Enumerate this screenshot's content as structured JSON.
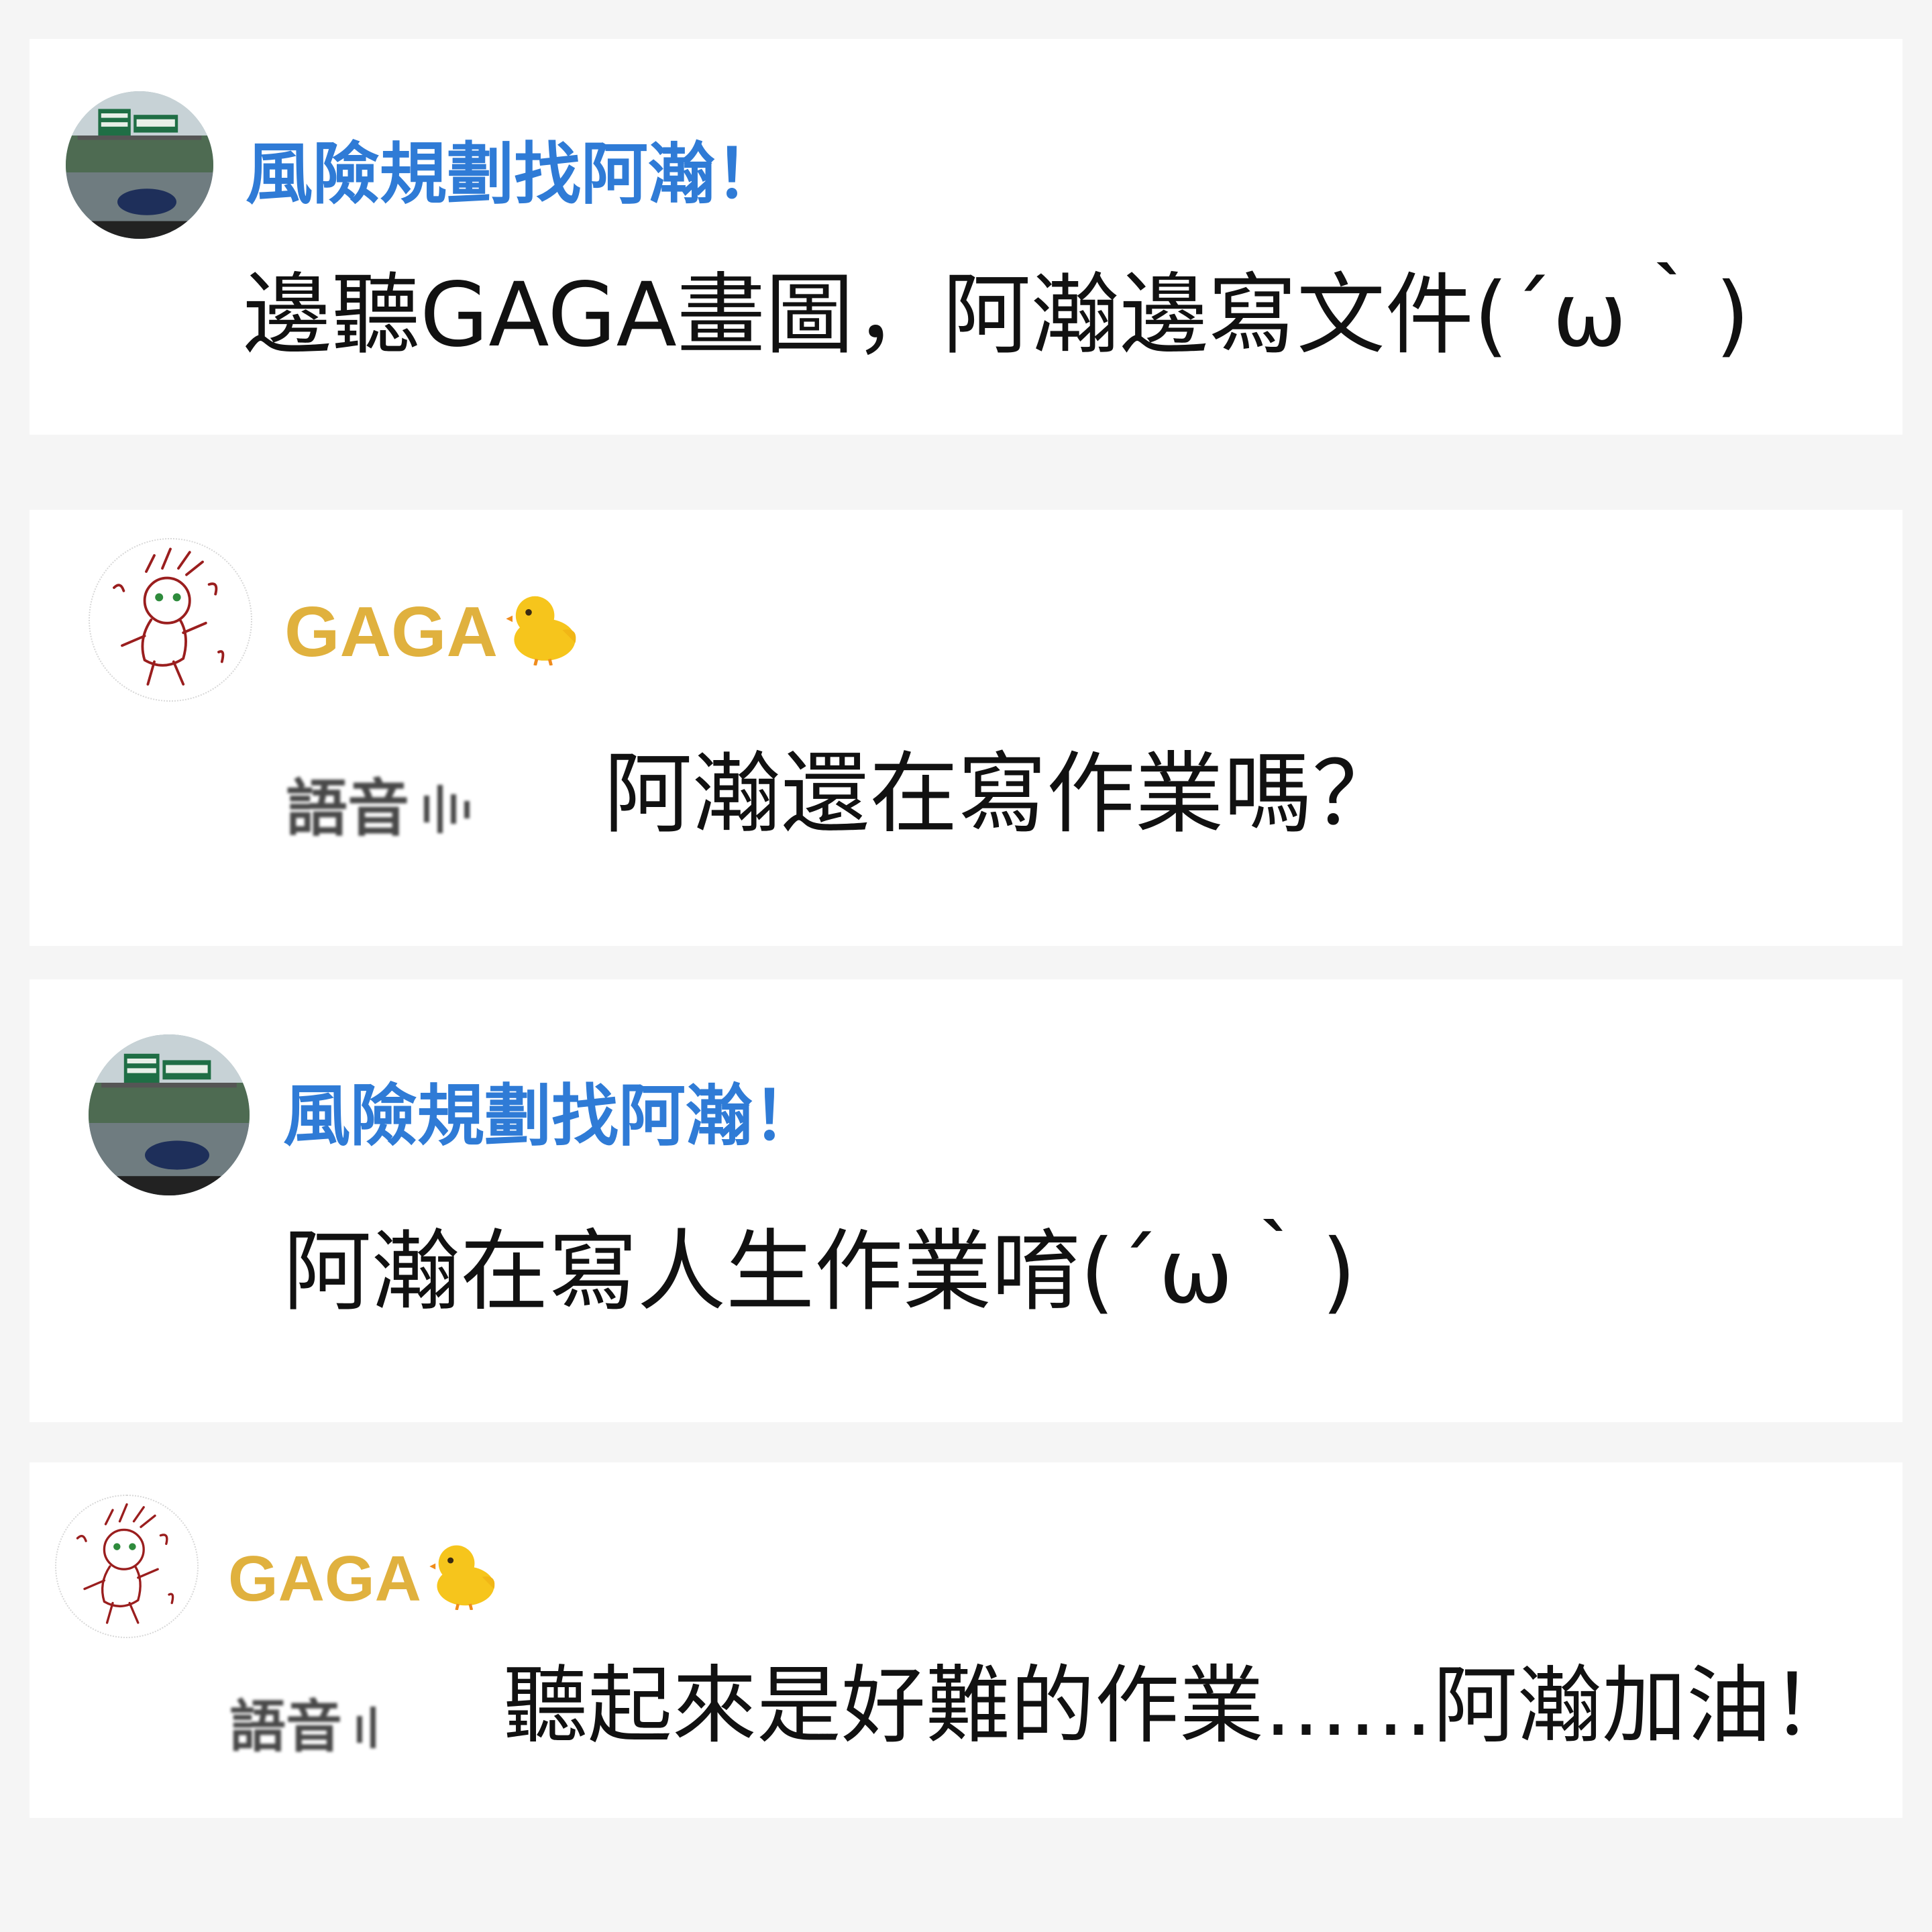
{
  "comments": [
    {
      "author": "風險規劃找阿瀚！",
      "avatar": "highway-photo-avatar",
      "text": "邊聽GAGA畫圖，阿瀚邊寫文件(´ω｀)"
    },
    {
      "author": "GAGA",
      "author_emoji": "chick-emoji",
      "avatar": "sketch-avatar",
      "voice_label": "語音",
      "text": "阿瀚還在寫作業嗎？"
    },
    {
      "author": "風險規劃找阿瀚！",
      "avatar": "highway-photo-avatar",
      "text": "阿瀚在寫人生作業唷(´ω｀)"
    },
    {
      "author": "GAGA",
      "author_emoji": "chick-emoji",
      "avatar": "sketch-avatar",
      "voice_label": "語音",
      "text": "聽起來是好難的作業……阿瀚加油！"
    }
  ],
  "colors": {
    "name_blue": "#2f7bd6",
    "name_gold": "#e0b13e",
    "message_text": "#111111",
    "background": "#f5f5f5",
    "card": "#ffffff"
  }
}
